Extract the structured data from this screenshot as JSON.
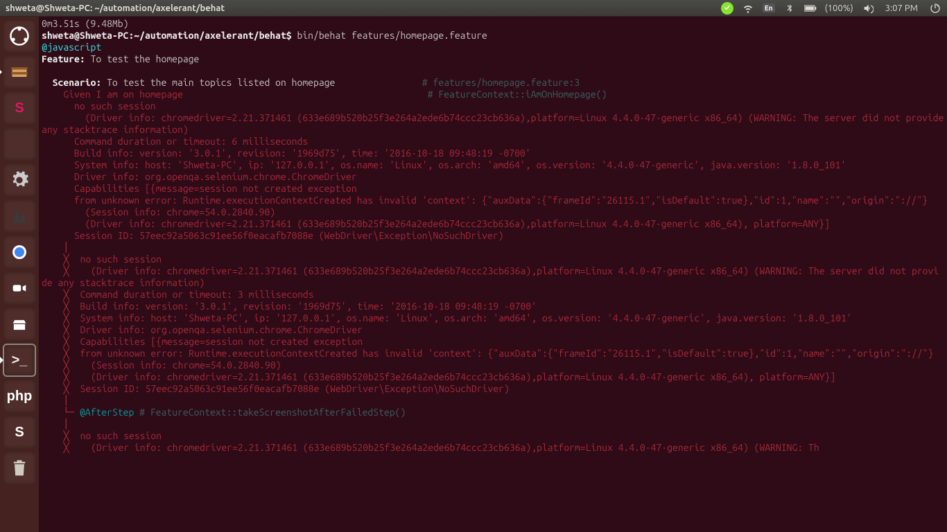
{
  "topbar": {
    "title": "shweta@Shweta-PC: ~/automation/axelerant/behat",
    "battery": "(100%)",
    "clock": "3:07 PM",
    "lang": "En"
  },
  "launcher": {
    "items": [
      {
        "name": "ubuntu-dash",
        "label": ""
      },
      {
        "name": "files",
        "label": ""
      },
      {
        "name": "slack",
        "label": "S"
      },
      {
        "name": "firefox",
        "label": ""
      },
      {
        "name": "settings",
        "label": ""
      },
      {
        "name": "gimp",
        "label": ""
      },
      {
        "name": "chrome",
        "label": ""
      },
      {
        "name": "zoom",
        "label": ""
      },
      {
        "name": "software-center",
        "label": ""
      },
      {
        "name": "terminal",
        "label": ">_"
      },
      {
        "name": "phpstorm",
        "label": "php"
      },
      {
        "name": "skype",
        "label": "S"
      },
      {
        "name": "trash",
        "label": ""
      }
    ]
  },
  "term": {
    "l0": "0m3.51s (9.48Mb)",
    "prompt": "shweta@Shweta-PC:~/automation/axelerant/behat$ ",
    "cmd": "bin/behat features/homepage.feature",
    "tag": "@javascript",
    "feat_kw": "Feature:",
    "feat_txt": " To test the homepage",
    "scen_kw": "  Scenario:",
    "scen_txt": " To test the main topics listed on homepage",
    "scen_c": "# features/homepage.feature:3",
    "given_kw": "    Given ",
    "given_txt": "I am on homepage",
    "given_c": "# FeatureContext::iAmOnHomepage()",
    "err01": "      no such session",
    "err02": "        (Driver info: chromedriver=2.21.371461 (633e689b520b25f3e264a2ede6b74ccc23cb636a),platform=Linux 4.4.0-47-generic x86_64) (WARNING: The server did not provide any stacktrace information)",
    "err03": "      Command duration or timeout: 6 milliseconds",
    "err04": "      Build info: version: '3.0.1', revision: '1969d75', time: '2016-10-18 09:48:19 -0700'",
    "err05": "      System info: host: 'Shweta-PC', ip: '127.0.0.1', os.name: 'Linux', os.arch: 'amd64', os.version: '4.4.0-47-generic', java.version: '1.8.0_101'",
    "err06": "      Driver info: org.openqa.selenium.chrome.ChromeDriver",
    "err07": "      Capabilities [{message=session not created exception",
    "err08": "      from unknown error: Runtime.executionContextCreated has invalid 'context': {\"auxData\":{\"frameId\":\"26115.1\",\"isDefault\":true},\"id\":1,\"name\":\"\",\"origin\":\"://\"}",
    "err09": "        (Session info: chrome=54.0.2840.90)",
    "err10": "        (Driver info: chromedriver=2.21.371461 (633e689b520b25f3e264a2ede6b74ccc23cb636a),platform=Linux 4.4.0-47-generic x86_64), platform=ANY}]",
    "err11": "      Session ID: 57eec92a5063c91ee56f0eacafb7088e (WebDriver\\Exception\\NoSuchDriver)",
    "tree1": "    │",
    "tree2": "    ╳  ",
    "err12": "no such session",
    "err13": "  (Driver info: chromedriver=2.21.371461 (633e689b520b25f3e264a2ede6b74ccc23cb636a),platform=Linux 4.4.0-47-generic x86_64) (WARNING: The server did not provide any stacktrace information)",
    "err14": "Command duration or timeout: 3 milliseconds",
    "err15": "Build info: version: '3.0.1', revision: '1969d75', time: '2016-10-18 09:48:19 -0700'",
    "err16": "System info: host: 'Shweta-PC', ip: '127.0.0.1', os.name: 'Linux', os.arch: 'amd64', os.version: '4.4.0-47-generic', java.version: '1.8.0_101'",
    "err17": "Driver info: org.openqa.selenium.chrome.ChromeDriver",
    "err18": "Capabilities [{message=session not created exception",
    "err19": "from unknown error: Runtime.executionContextCreated has invalid 'context': {\"auxData\":{\"frameId\":\"26115.1\",\"isDefault\":true},\"id\":1,\"name\":\"\",\"origin\":\"://\"}",
    "err20": "  (Session info: chrome=54.0.2840.90)",
    "err21": "  (Driver info: chromedriver=2.21.371461 (633e689b520b25f3e264a2ede6b74ccc23cb636a),platform=Linux 4.4.0-47-generic x86_64), platform=ANY}]",
    "err22": "Session ID: 57eec92a5063c91ee56f0eacafb7088e (WebDriver\\Exception\\NoSuchDriver)",
    "tree3": "    │",
    "tree4": "    └─ ",
    "after_kw": "@AfterStep",
    "after_c": " # FeatureContext::takeScreenshotAfterFailedStep()",
    "err23": "no such session",
    "err24": "  (Driver info: chromedriver=2.21.371461 (633e689b520b25f3e264a2ede6b74ccc23cb636a),platform=Linux 4.4.0-47-generic x86_64) (WARNING: Th"
  }
}
